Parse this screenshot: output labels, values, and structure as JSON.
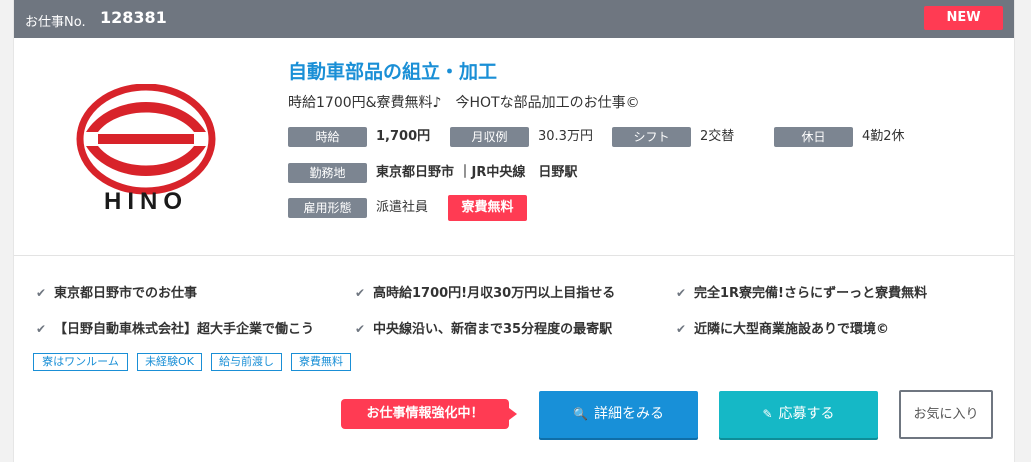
{
  "header": {
    "job_no_label": "お仕事No.",
    "job_no": "128381",
    "new_badge": "NEW"
  },
  "logo": {
    "brand_text": "HINO",
    "color_red": "#d8232a",
    "color_black": "#1a1a1a"
  },
  "job": {
    "title": "自動車部品の組立・加工",
    "subtitle": "時給1700円&寮費無料♪　今HOTな部品加工のお仕事©",
    "wage_label": "時給",
    "wage_value": "1,700円",
    "monthly_label": "月収例",
    "monthly_value": "30.3万円",
    "shift_label": "シフト",
    "shift_value": "2交替",
    "holiday_label": "休日",
    "holiday_value": "4勤2休",
    "location_label": "勤務地",
    "location_value": "東京都日野市 ｜JR中央線　日野駅",
    "employment_label": "雇用形態",
    "employment_value": "派遣社員",
    "ryohi_badge": "寮費無料"
  },
  "features": [
    "東京都日野市でのお仕事",
    "高時給1700円!月収30万円以上目指せる",
    "完全1R寮完備!さらにずーっと寮費無料",
    "【日野自動車株式会社】超大手企業で働こう",
    "中央線沿い、新宿まで35分程度の最寄駅",
    "近隣に大型商業施設ありで環境©"
  ],
  "tags": [
    "寮はワンルーム",
    "未経験OK",
    "給与前渡し",
    "寮費無料"
  ],
  "actions": {
    "callout": "お仕事情報強化中！",
    "detail": "詳細をみる",
    "apply": "応募する",
    "favorite": "お気に入り"
  },
  "colors": {
    "accent_blue": "#1890d8",
    "accent_teal": "#15b8c6",
    "accent_red": "#ff3b53",
    "header_gray": "#6f7680"
  }
}
